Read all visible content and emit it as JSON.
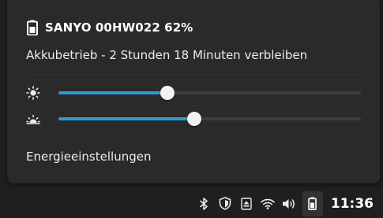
{
  "battery_popup": {
    "title": "SANYO 00HW022 62%",
    "battery_percent": 62,
    "status": "Akkubetrieb - 2 Stunden 18 Minuten verbleiben",
    "sliders": [
      {
        "id": "screen-brightness",
        "icon": "sun-icon",
        "level_percent": 36
      },
      {
        "id": "keyboard-brightness",
        "icon": "sunset-icon",
        "level_percent": 45
      }
    ],
    "settings_link": "Energieeinstellungen"
  },
  "taskbar": {
    "tray_icons": [
      "bluetooth-icon",
      "shield-icon",
      "eject-icon",
      "wifi-icon",
      "volume-icon",
      "battery-icon"
    ],
    "clock": "11:36"
  },
  "colors": {
    "accent": "#2f9bd6",
    "popup_bg": "#2a2a2a",
    "panel_bg": "#1f1f1f",
    "text": "#ececec"
  }
}
